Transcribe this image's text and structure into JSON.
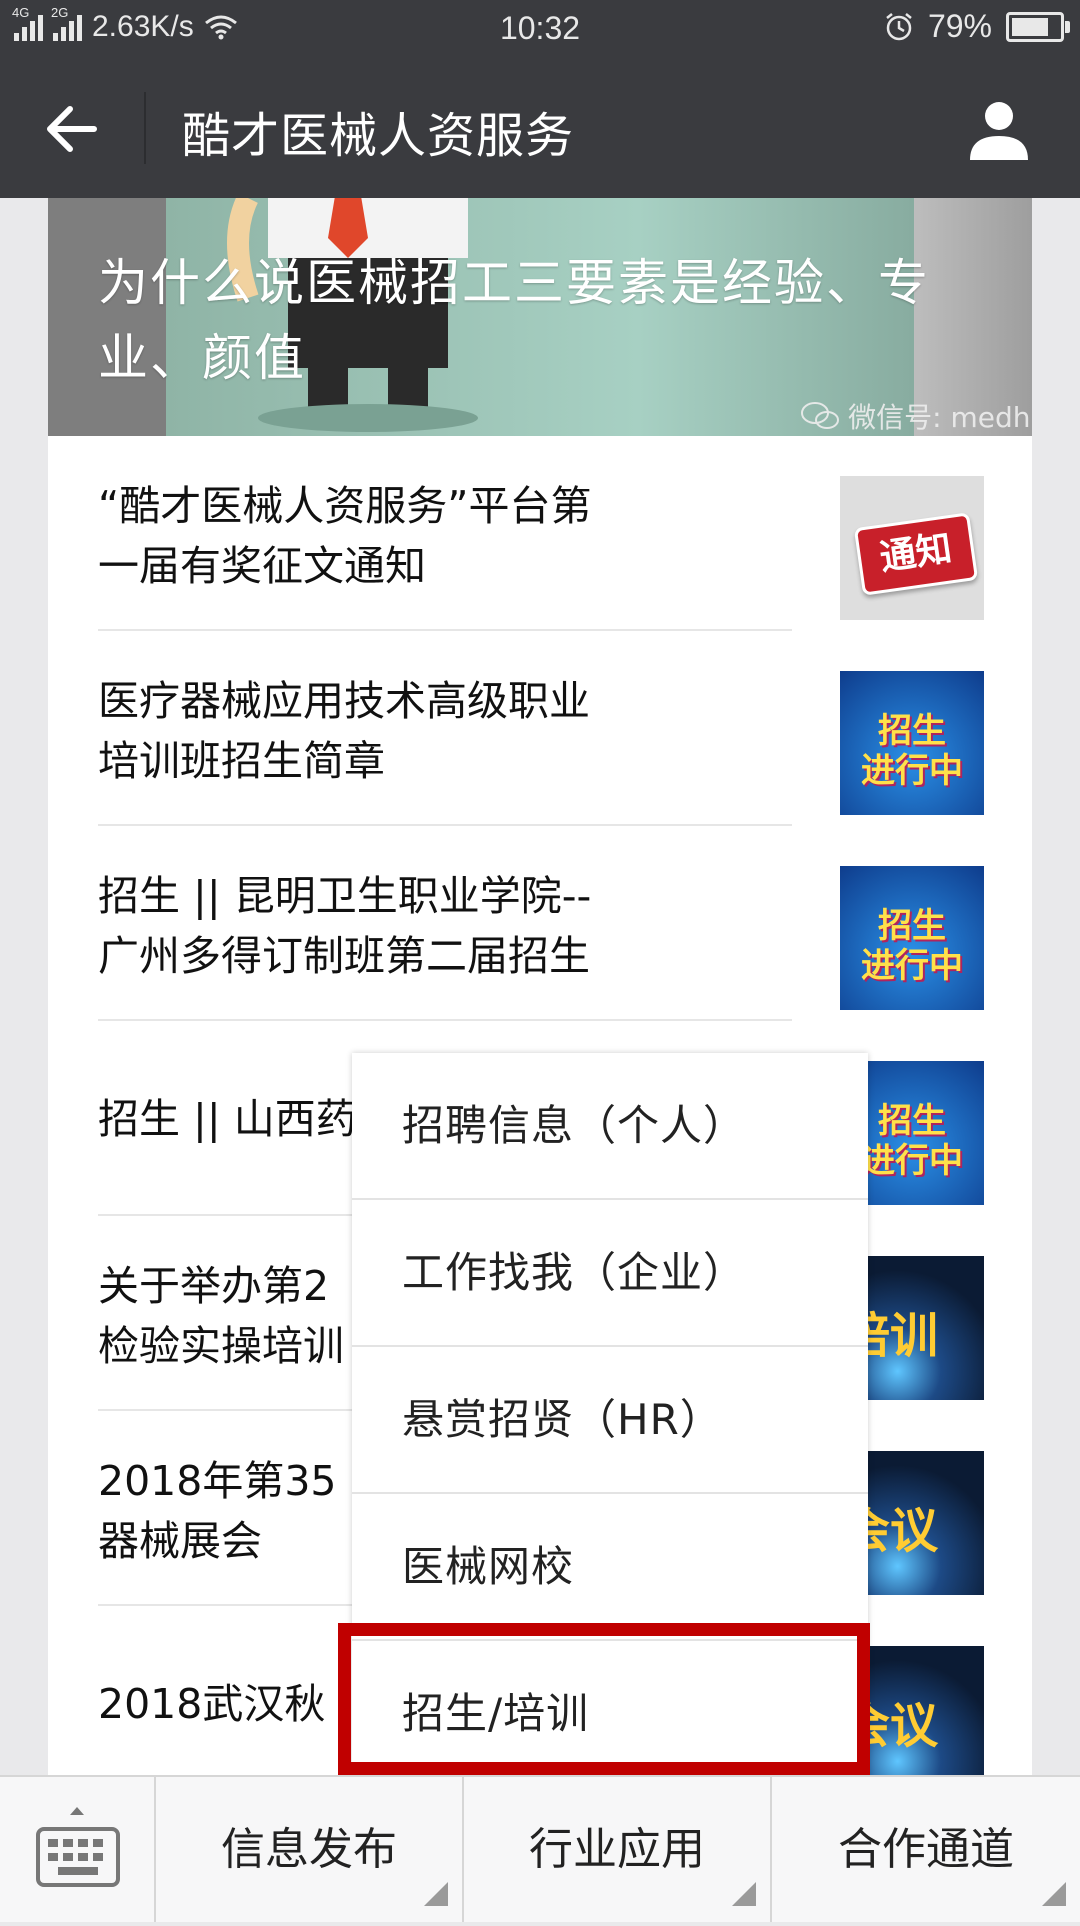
{
  "status_bar": {
    "net1": "4G",
    "net2": "2G",
    "speed": "2.63K/s",
    "time": "10:32",
    "battery": "79%",
    "battery_level": 0.79
  },
  "header": {
    "title": "酷才医械人资服务"
  },
  "banner": {
    "title": "为什么说医械招工三要素是经验、专业、颜值",
    "watermark": "微信号: medhr"
  },
  "articles": [
    {
      "title": "“酷才医械人资服务”平台第一届有奖征文通知",
      "thumb_text": "通知"
    },
    {
      "title": "医疗器械应用技术高级职业培训班招生简章",
      "thumb_text_1": "招生",
      "thumb_text_2": "进行中"
    },
    {
      "title": "招生 || 昆明卫生职业学院--广州多得订制班第二届招生",
      "thumb_text_1": "招生",
      "thumb_text_2": "进行中"
    },
    {
      "title": "招生 || 山西药",
      "thumb_text_1": "招生",
      "thumb_text_2": "进行中"
    },
    {
      "title": "关于举办第2\n检验实操培训",
      "thumb_text": "培训"
    },
    {
      "title": "2018年第35\n器械展会",
      "thumb_text": "会议"
    },
    {
      "title": "2018武汉秋",
      "thumb_text": "会议"
    }
  ],
  "popup_menu": {
    "items": [
      "招聘信息（个人）",
      "工作找我（企业）",
      "悬赏招贤（HR）",
      "医械网校",
      "招生/培训"
    ],
    "highlighted_index": 4
  },
  "bottom_tabs": [
    "信息发布",
    "行业应用",
    "合作通道"
  ],
  "colors": {
    "header_bg": "#3a3b3f",
    "highlight": "#c00000"
  }
}
